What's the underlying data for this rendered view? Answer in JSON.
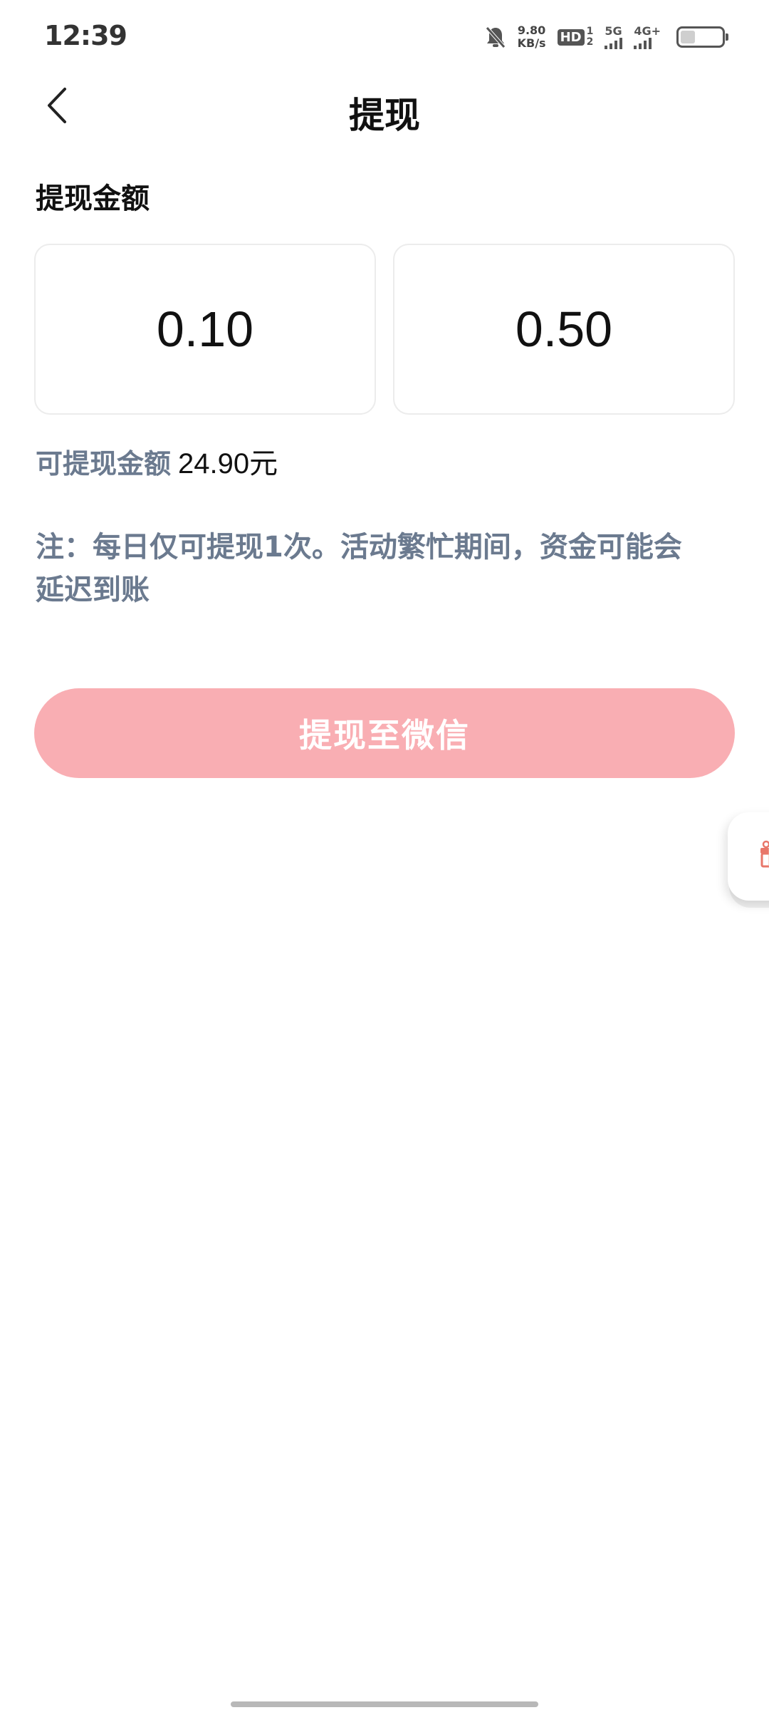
{
  "status_bar": {
    "time": "12:39",
    "net_speed_value": "9.80",
    "net_speed_unit": "KB/s",
    "hd_label": "HD",
    "hd_sup": "1",
    "hd_sub": "2",
    "signal_1_label": "5G",
    "signal_2_label": "4G+",
    "battery_level": "5",
    "icons": [
      "mute-bell-icon",
      "battery-icon"
    ]
  },
  "header": {
    "title": "提现",
    "back_icon": "chevron-left-icon"
  },
  "withdraw": {
    "section_label": "提现金额",
    "options": [
      "0.10",
      "0.50"
    ],
    "available_label": "可提现金额",
    "available_amount": "24.90元",
    "notice_line1": "注：每日仅可提现1次。活动繁忙期间，资金可能会",
    "notice_line2": "延迟到账",
    "button_label": "提现至微信"
  },
  "colors": {
    "button_bg": "#f9aeb3",
    "muted_text": "#6b7a8f",
    "widget_accent": "#e8776a"
  }
}
